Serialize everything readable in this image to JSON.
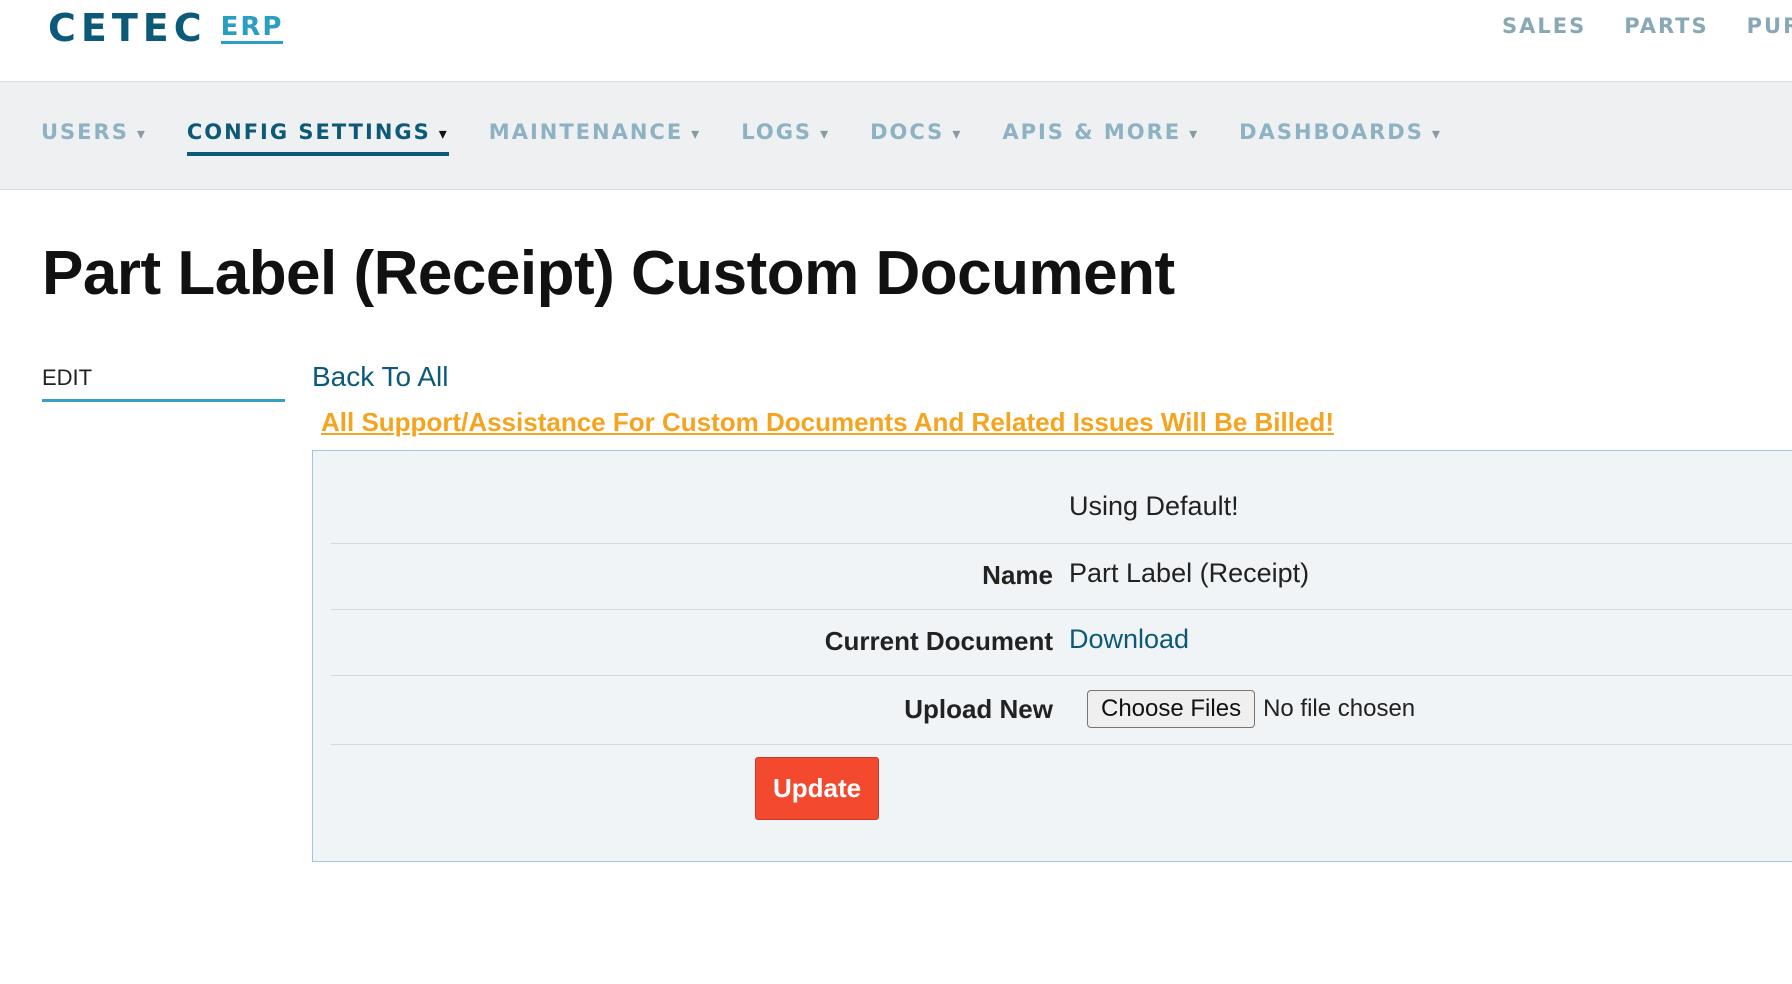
{
  "header": {
    "logo_main": "CETEC",
    "logo_sub": "ERP",
    "top_nav": [
      "SALES",
      "PARTS",
      "PURC"
    ]
  },
  "sub_nav": {
    "items": [
      {
        "label": "USERS",
        "active": false
      },
      {
        "label": "CONFIG SETTINGS",
        "active": true
      },
      {
        "label": "MAINTENANCE",
        "active": false
      },
      {
        "label": "LOGS",
        "active": false
      },
      {
        "label": "DOCS",
        "active": false
      },
      {
        "label": "APIS & MORE",
        "active": false
      },
      {
        "label": "DASHBOARDS",
        "active": false
      }
    ],
    "caret": "▾"
  },
  "page": {
    "title": "Part Label (Receipt) Custom Document",
    "side_tab": "EDIT",
    "back_link": "Back To All",
    "warning": "All Support/Assistance For Custom Documents And Related Issues Will Be Billed!"
  },
  "form": {
    "status": "Using Default!",
    "name_label": "Name",
    "name_value": "Part Label (Receipt)",
    "current_doc_label": "Current Document",
    "current_doc_link": "Download",
    "upload_label": "Upload New",
    "choose_files": "Choose Files",
    "no_file": "No file chosen",
    "update": "Update"
  },
  "colors": {
    "brand": "#0c5a78",
    "brand_light": "#2a9fc0",
    "warning": "#f5a41f",
    "update_button": "#f2492f"
  }
}
